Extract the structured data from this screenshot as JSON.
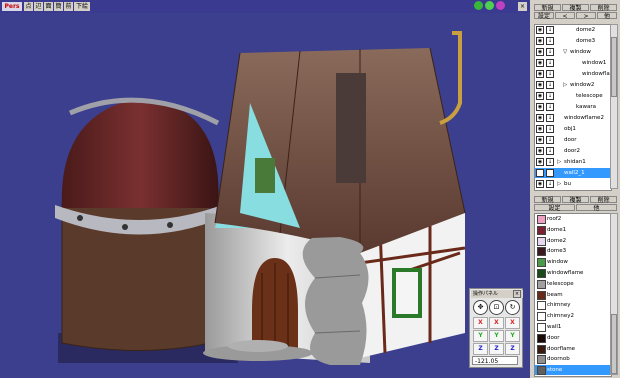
{
  "toolbar": {
    "mode_label": "Pers",
    "buttons": [
      "点",
      "辺",
      "面",
      "簡",
      "前",
      "下絵"
    ]
  },
  "object_panel": {
    "buttons": [
      [
        "新規",
        "複製",
        "削除"
      ],
      [
        "設定",
        "<",
        ">",
        "他"
      ]
    ],
    "items": [
      {
        "label": "dome2",
        "indent": 2,
        "expand": ""
      },
      {
        "label": "dome3",
        "indent": 2,
        "expand": ""
      },
      {
        "label": "window",
        "indent": 1,
        "expand": "▽"
      },
      {
        "label": "window1",
        "indent": 3,
        "expand": ""
      },
      {
        "label": "windowfla",
        "indent": 3,
        "expand": ""
      },
      {
        "label": "window2",
        "indent": 1,
        "expand": "▷"
      },
      {
        "label": "telescope",
        "indent": 2,
        "expand": ""
      },
      {
        "label": "kawara",
        "indent": 2,
        "expand": ""
      },
      {
        "label": "windowflame2",
        "indent": 0,
        "expand": ""
      },
      {
        "label": "obj1",
        "indent": 0,
        "expand": ""
      },
      {
        "label": "door",
        "indent": 0,
        "expand": ""
      },
      {
        "label": "door2",
        "indent": 0,
        "expand": ""
      },
      {
        "label": "shidan1",
        "indent": 0,
        "expand": "▷"
      },
      {
        "label": "wall2_1",
        "indent": 0,
        "expand": "",
        "selected": true
      },
      {
        "label": "bu",
        "indent": 0,
        "expand": "▷"
      }
    ]
  },
  "material_panel": {
    "buttons": [
      [
        "新規",
        "複製",
        "削除"
      ],
      [
        "設定",
        "他"
      ]
    ],
    "items": [
      {
        "label": "roof2",
        "color": "#f0a0c0"
      },
      {
        "label": "dome1",
        "color": "#7a2030"
      },
      {
        "label": "dome2",
        "color": "#e8d8f0"
      },
      {
        "label": "dome3",
        "color": "#3a1a20"
      },
      {
        "label": "window",
        "color": "#4a9a4a"
      },
      {
        "label": "windowflame",
        "color": "#1a4a1a"
      },
      {
        "label": "telescope",
        "color": "#a0a0a0"
      },
      {
        "label": "beam",
        "color": "#6a2a1a"
      },
      {
        "label": "chimney",
        "color": "#ffffff"
      },
      {
        "label": "chimney2",
        "color": "#ffffff"
      },
      {
        "label": "wall1",
        "color": "#ffffff"
      },
      {
        "label": "door",
        "color": "#1a0a08"
      },
      {
        "label": "doorflame",
        "color": "#3a1a10"
      },
      {
        "label": "doornob",
        "color": "#909090"
      },
      {
        "label": "stone",
        "color": "#606060",
        "selected": true
      }
    ]
  },
  "op_panel": {
    "title": "操作パネル",
    "close": "×",
    "circle_icons": [
      "move-icon",
      "scale-icon",
      "rotate-icon"
    ],
    "circle_glyphs": [
      "✥",
      "⊡",
      "↻"
    ],
    "axis_rows": [
      [
        "X",
        "X",
        "X"
      ],
      [
        "Y",
        "Y",
        "Y"
      ],
      [
        "Z",
        "Z",
        "Z"
      ]
    ],
    "axis_colors": {
      "X": "#dd2222",
      "Y": "#22aa22",
      "Z": "#2222cc"
    },
    "value": "-121.05"
  },
  "colors": {
    "viewport_bg": "#3b3f8e",
    "selection": "#3399ff"
  }
}
